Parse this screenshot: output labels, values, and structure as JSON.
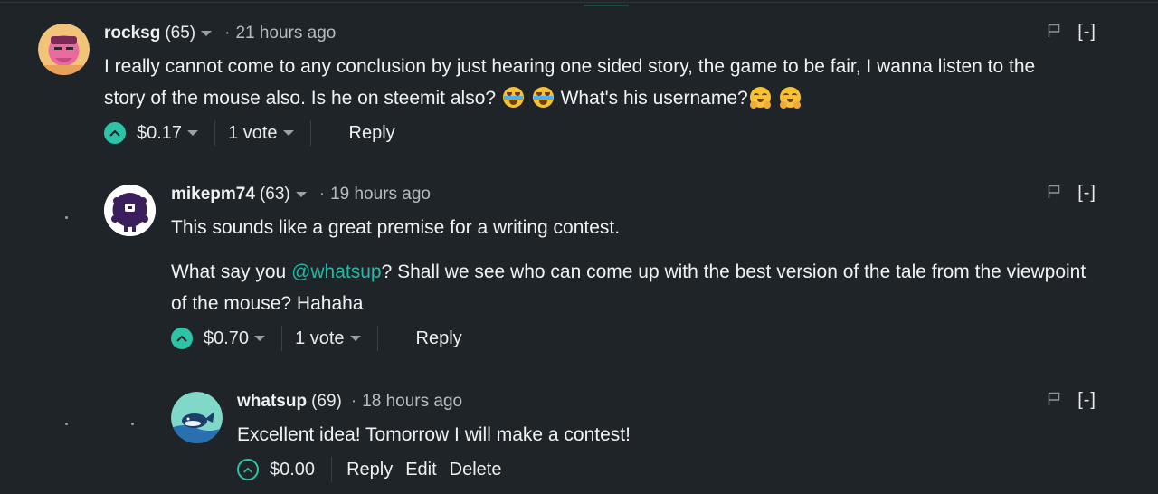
{
  "comments": [
    {
      "author": "rocksg",
      "rep": "(65)",
      "sep": "·",
      "time": "21 hours ago",
      "collapse": "[-]",
      "text_line1": "I really cannot come to any conclusion by just hearing one sided story, the game to be fair, I wanna listen to the",
      "text_line2": "story of the mouse also. Is he on steemit also?",
      "text_line2b": "What's his username?",
      "payout": "$0.17",
      "votes": "1 vote",
      "reply": "Reply"
    },
    {
      "author": "mikepm74",
      "rep": "(63)",
      "sep": "·",
      "time": "19 hours ago",
      "collapse": "[-]",
      "para1": "This sounds like a great premise for a writing contest.",
      "para2_pre": "What say you ",
      "mention": "@whatsup",
      "para2_post": "? Shall we see who can come up with the best version of the tale from the viewpoint of the mouse? Hahaha",
      "payout": "$0.70",
      "votes": "1 vote",
      "reply": "Reply"
    },
    {
      "author": "whatsup",
      "rep": "(69)",
      "sep": "·",
      "time": "18 hours ago",
      "collapse": "[-]",
      "text": "Excellent idea! Tomorrow I will make a contest!",
      "payout": "$0.00",
      "reply": "Reply",
      "edit": "Edit",
      "delete": "Delete"
    }
  ],
  "icons": {
    "upvote": "chevron-up-icon",
    "flag": "flag-icon",
    "dropdown": "caret-down-icon",
    "emoji_cry": "crying-laughing-emoji",
    "emoji_hug": "hugging-face-emoji"
  },
  "colors": {
    "background": "#1f2428",
    "accent": "#2cc3a7",
    "mention": "#27b6a4"
  }
}
